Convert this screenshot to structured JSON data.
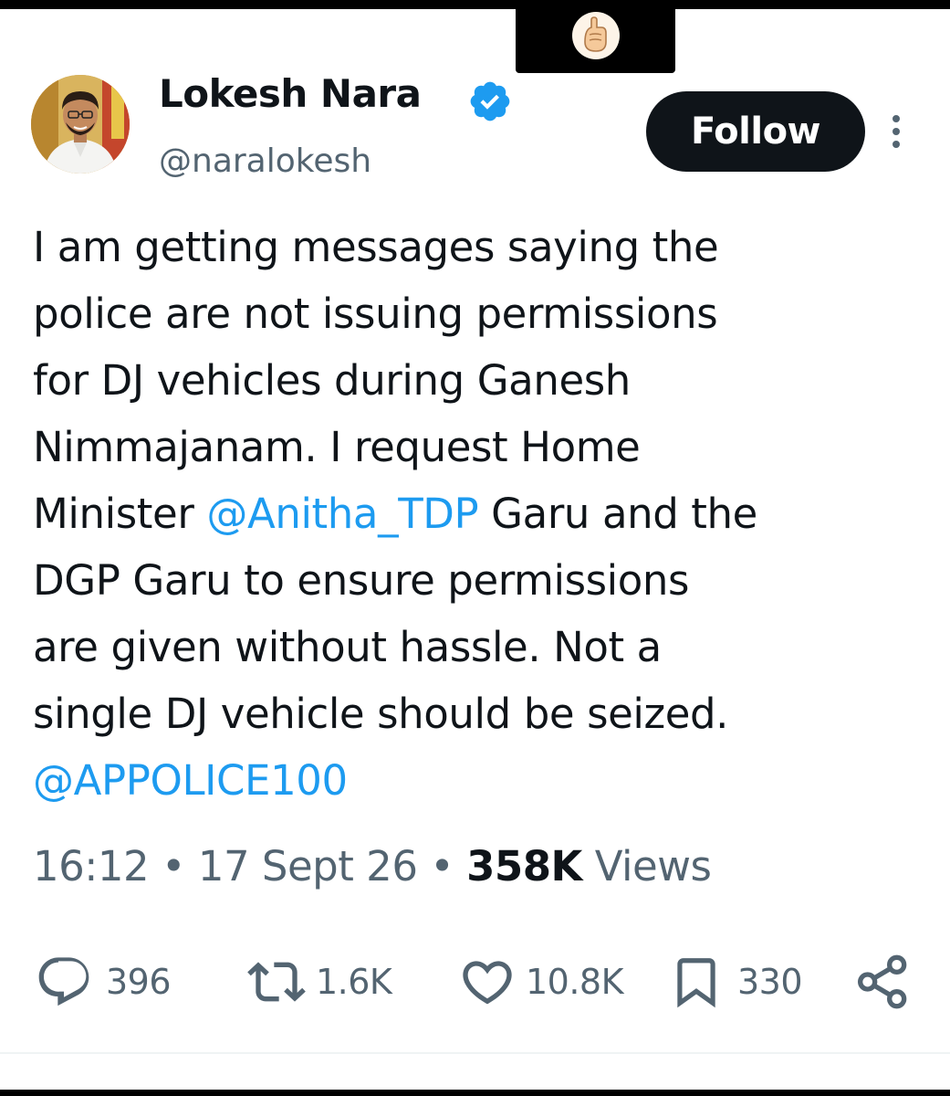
{
  "author": {
    "name": "Lokesh Nara",
    "handle": "@naralokesh",
    "verified_icon": "verified-badge-icon",
    "avatar_icon": "profile-avatar"
  },
  "follow_label": "Follow",
  "tweet": {
    "lines": [
      [
        {
          "text": "I am getting messages saying the"
        }
      ],
      [
        {
          "text": "police are not issuing permissions"
        }
      ],
      [
        {
          "text": "for DJ vehicles during Ganesh"
        }
      ],
      [
        {
          "text": "Nimmajanam. I request Home"
        }
      ],
      [
        {
          "text": "Minister "
        },
        {
          "text": "@Anitha_TDP",
          "mention": true
        },
        {
          "text": " Garu and the"
        }
      ],
      [
        {
          "text": "DGP Garu to ensure permissions"
        }
      ],
      [
        {
          "text": "are given without hassle. Not a"
        }
      ],
      [
        {
          "text": "single DJ vehicle should be seized."
        }
      ],
      [
        {
          "text": "@APPOLICE100",
          "mention": true
        }
      ]
    ]
  },
  "meta": {
    "time": "16:12",
    "separator": "•",
    "date": "17 Sept 26",
    "views_count": "358K",
    "views_label": "Views"
  },
  "actions": {
    "replies": "396",
    "reposts": "1.6K",
    "likes": "10.8K",
    "bookmarks": "330"
  },
  "colors": {
    "text": "#0f1419",
    "secondary": "#536471",
    "accent": "#1d9bf0",
    "follow_bg": "#0f1419"
  },
  "icons": [
    "reply-icon",
    "repost-icon",
    "like-icon",
    "bookmark-icon",
    "share-icon",
    "more-options-icon",
    "fist-emoji-icon"
  ]
}
